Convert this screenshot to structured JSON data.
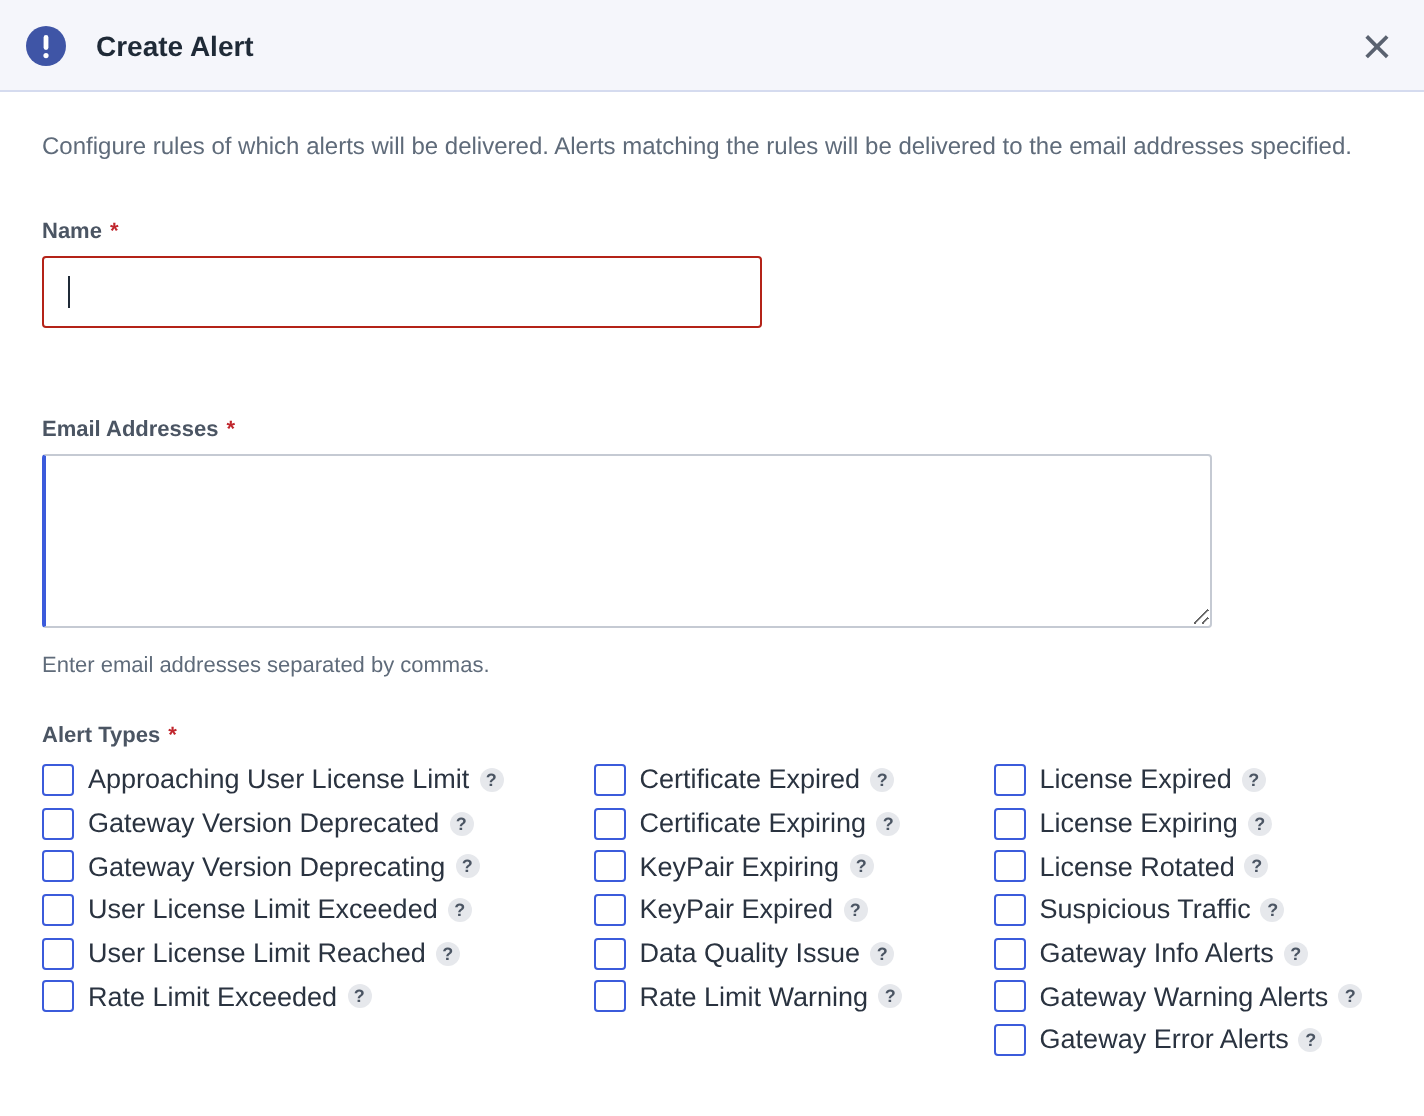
{
  "dialog": {
    "title": "Create Alert",
    "close": "×"
  },
  "description": "Configure rules of which alerts will be delivered. Alerts matching the rules will be delivered to the email addresses specified.",
  "name_field": {
    "label": "Name",
    "required": "*",
    "invalid": true,
    "focused": true
  },
  "email_field": {
    "label": "Email Addresses",
    "required": "*",
    "hint": "Enter email addresses separated by commas."
  },
  "alert_types": {
    "label": "Alert Types",
    "required": "*",
    "columns": [
      [
        {
          "label": "Approaching User License Limit",
          "checked": false,
          "help": "?"
        },
        {
          "label": "Gateway Version Deprecated",
          "checked": false,
          "help": "?"
        },
        {
          "label": "Gateway Version Deprecating",
          "checked": false,
          "help": "?"
        },
        {
          "label": "User License Limit Exceeded",
          "checked": false,
          "help": "?"
        },
        {
          "label": "User License Limit Reached",
          "checked": false,
          "help": "?"
        },
        {
          "label": "Rate Limit Exceeded",
          "checked": false,
          "help": "?"
        }
      ],
      [
        {
          "label": "Certificate Expired",
          "checked": false,
          "help": "?"
        },
        {
          "label": "Certificate Expiring",
          "checked": false,
          "help": "?"
        },
        {
          "label": "KeyPair Expiring",
          "checked": false,
          "help": "?"
        },
        {
          "label": "KeyPair Expired",
          "checked": false,
          "help": "?"
        },
        {
          "label": "Data Quality Issue",
          "checked": false,
          "help": "?"
        },
        {
          "label": "Rate Limit Warning",
          "checked": false,
          "help": "?"
        }
      ],
      [
        {
          "label": "License Expired",
          "checked": false,
          "help": "?"
        },
        {
          "label": "License Expiring",
          "checked": false,
          "help": "?"
        },
        {
          "label": "License Rotated",
          "checked": false,
          "help": "?"
        },
        {
          "label": "Suspicious Traffic",
          "checked": false,
          "help": "?"
        },
        {
          "label": "Gateway Info Alerts",
          "checked": false,
          "help": "?"
        },
        {
          "label": "Gateway Warning Alerts",
          "checked": false,
          "help": "?"
        },
        {
          "label": "Gateway Error Alerts",
          "checked": false,
          "help": "?"
        }
      ]
    ]
  }
}
